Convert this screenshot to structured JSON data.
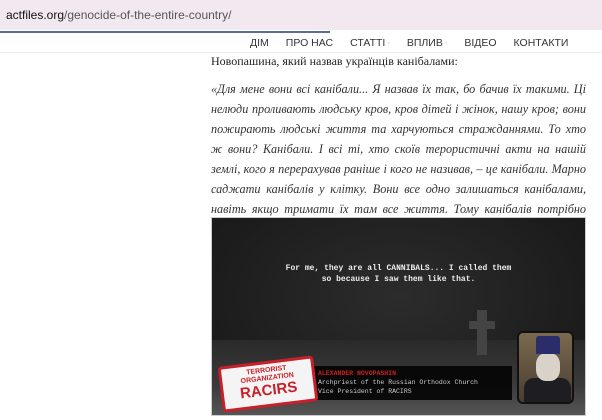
{
  "browser": {
    "url_domain": "actfiles.org",
    "url_path": "/genocide-of-the-entire-country/"
  },
  "nav": {
    "items": [
      {
        "label": "ДІМ",
        "has_submenu": false
      },
      {
        "label": "ПРО НАС",
        "has_submenu": false
      },
      {
        "label": "СТАТТІ",
        "has_submenu": true
      },
      {
        "label": "ВПЛИВ",
        "has_submenu": true
      },
      {
        "label": "ВІДЕО",
        "has_submenu": false
      },
      {
        "label": "КОНТАКТИ",
        "has_submenu": false
      }
    ],
    "submenu_marker": "◦"
  },
  "article": {
    "intro": "Новопашина, який назвав українців канібалами:",
    "quote": "«Для мене вони всі канібали... Я назвав їх так, бо бачив їх такими. Ці нелюди проливають людську кров, кров дітей і жінок, нашу кров; вони пожирають людські життя та харчуються стражданнями. То хто ж вони? Канібали. І всі ті, хто скоїв терористичні акти на нашій землі, кого я перерахував раніше і кого не називав, – це канібали. Марно саджати канібалів у клітку. Вони все одно залишаться канібалами, навіть якщо тримати їх там все життя. Тому канібалів потрібно знищувати»."
  },
  "video": {
    "subtitle_line1": "For me, they are all CANNIBALS... I called them",
    "subtitle_line2": "so because I saw them like that.",
    "person_name": "ALEXANDER NOVOPASHIN",
    "person_title1": "Archpriest of the Russian Orthodox Church",
    "person_title2": "Vice President of RACIRS",
    "stamp_line1": "TERRORIST",
    "stamp_line2": "ORGANIZATION",
    "stamp_line3": "RACIRS",
    "accent_color": "#c8202a"
  }
}
